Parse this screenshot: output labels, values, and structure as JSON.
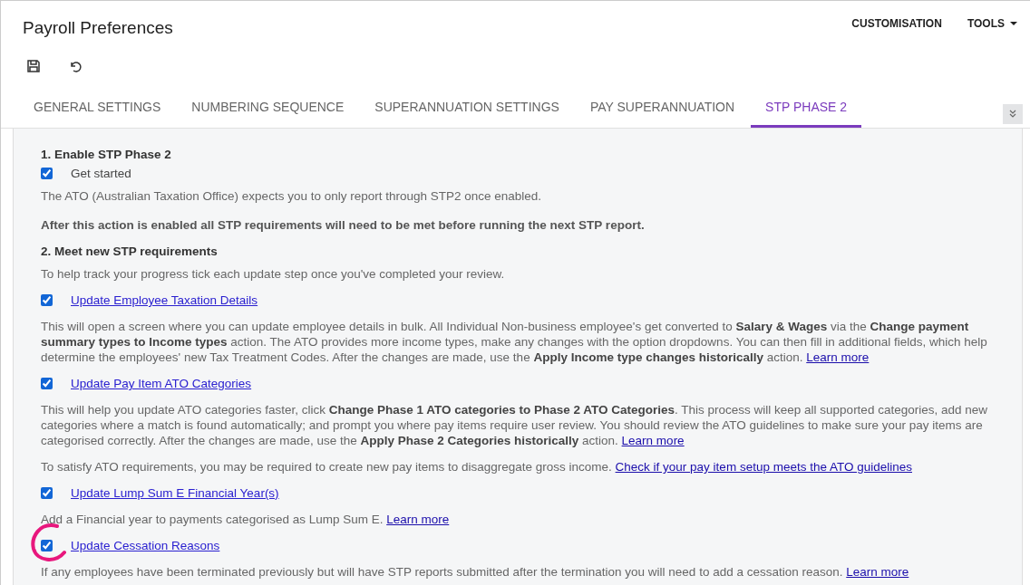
{
  "window": {
    "title": "Payroll Preferences"
  },
  "header_menu": [
    {
      "label": "CUSTOMISATION",
      "dropdown": false
    },
    {
      "label": "TOOLS",
      "dropdown": true
    }
  ],
  "tabs": [
    {
      "label": "GENERAL SETTINGS",
      "selected": false
    },
    {
      "label": "NUMBERING SEQUENCE",
      "selected": false
    },
    {
      "label": "SUPERANNUATION SETTINGS",
      "selected": false
    },
    {
      "label": "PAY SUPERANNUATION",
      "selected": false
    },
    {
      "label": "STP PHASE 2",
      "selected": true
    }
  ],
  "section1": {
    "heading": "1. Enable STP Phase 2",
    "checkbox": {
      "label": "Get started",
      "checked": true
    },
    "note": "The ATO (Australian Taxation Office) expects you to only report through STP2 once enabled.",
    "warning": "After this action is enabled all STP requirements will need to be met before running the next STP report."
  },
  "section2": {
    "heading": "2. Meet new STP requirements",
    "intro": "To help track your progress tick each update step once you've completed your review.",
    "steps": [
      {
        "label": "Update Employee Taxation Details",
        "checked": true,
        "highlighted": false,
        "paragraphs": [
          {
            "text": "This will open a screen where you can update employee details in bulk. All Individual Non-business employee's get converted to **Salary & Wages** via the **Change payment summary types to Income types** action. The ATO provides more income types, make any changes with the option dropdowns. You can then fill in additional fields, which help determine the employees' new Tax Treatment Codes. After the changes are made, use the **Apply Income type changes historically** action.",
            "link": "Learn more"
          }
        ]
      },
      {
        "label": "Update Pay Item ATO Categories",
        "checked": true,
        "highlighted": false,
        "paragraphs": [
          {
            "text": "This will help you update ATO categories faster, click **Change Phase 1 ATO categories to Phase 2 ATO Categories**. This process will keep all supported categories, add new categories where a match is found automatically; and prompt you where pay items require user review. You should review the ATO guidelines to make sure your pay items are categorised correctly. After the changes are made, use the **Apply Phase 2 Categories historically** action.",
            "link": "Learn more"
          },
          {
            "text": "To satisfy ATO requirements, you may be required to create new pay items to disaggregate gross income.",
            "link": "Check if your pay item setup meets the ATO guidelines"
          }
        ]
      },
      {
        "label": "Update Lump Sum E Financial Year(s)",
        "checked": true,
        "highlighted": false,
        "paragraphs": [
          {
            "text": "Add a Financial year to payments categorised as Lump Sum E.",
            "link": "Learn more"
          }
        ]
      },
      {
        "label": "Update Cessation Reasons",
        "checked": true,
        "highlighted": true,
        "paragraphs": [
          {
            "text": "If any employees have been terminated previously but will have STP reports submitted after the termination you will need to add a cessation reason.",
            "link": "Learn more"
          }
        ]
      }
    ]
  }
}
